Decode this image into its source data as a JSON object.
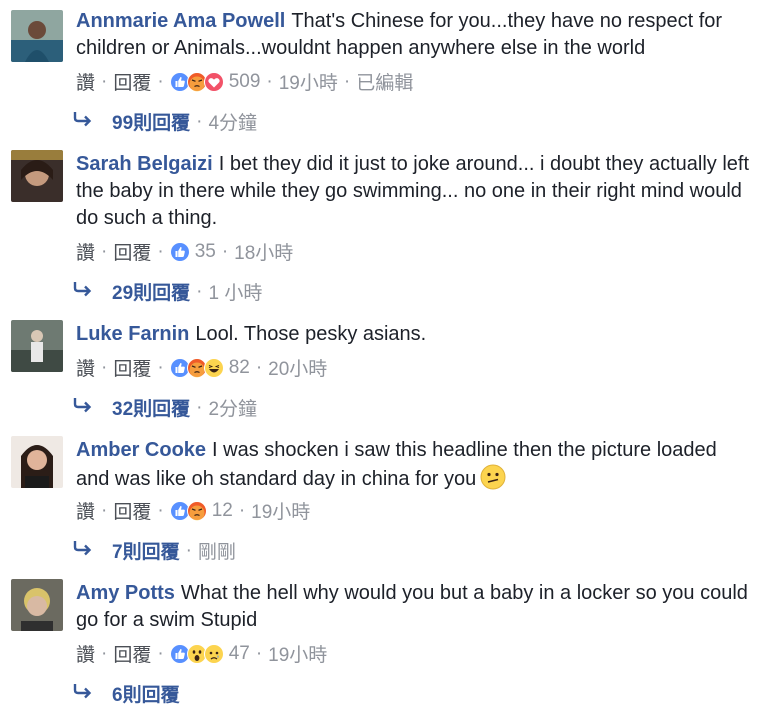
{
  "labels": {
    "like": "讚",
    "reply": "回覆",
    "dot": "·"
  },
  "comments": [
    {
      "author": "Annmarie Ama Powell",
      "text": "That's Chinese for you...they have no respect for children or Animals...wouldnt happen anywhere else in the world",
      "reactions": [
        "like-reaction-icon",
        "angry-reaction-icon",
        "love-reaction-icon"
      ],
      "count": "509",
      "time": "19小時",
      "edited": "已編輯",
      "replies_label": "99則回覆",
      "replies_time": "4分鐘"
    },
    {
      "author": "Sarah Belgaizi",
      "text": "I bet they did it just to joke around... i doubt they actually left the baby in there while they go swimming... no one in their right mind would do such a thing.",
      "reactions": [
        "like-reaction-icon"
      ],
      "count": "35",
      "time": "18小時",
      "replies_label": "29則回覆",
      "replies_time": "1 小時"
    },
    {
      "author": "Luke Farnin",
      "text": "Lool. Those pesky asians.",
      "reactions": [
        "like-reaction-icon",
        "angry-reaction-icon",
        "haha-reaction-icon"
      ],
      "count": "82",
      "time": "20小時",
      "replies_label": "32則回覆",
      "replies_time": "2分鐘"
    },
    {
      "author": "Amber Cooke",
      "text": "I was shocken i saw this headline then the picture loaded and was like oh standard day in china for you",
      "inline_emoji": "confused-emoji-icon",
      "reactions": [
        "like-reaction-icon",
        "angry-reaction-icon"
      ],
      "count": "12",
      "time": "19小時",
      "replies_label": "7則回覆",
      "replies_time": "剛剛"
    },
    {
      "author": "Amy Potts",
      "text": "What the hell why would you but a baby in a locker so you could go for a swim Stupid",
      "reactions": [
        "like-reaction-icon",
        "wow-reaction-icon",
        "sad-reaction-icon"
      ],
      "count": "47",
      "time": "19小時",
      "replies_label": "6則回覆"
    }
  ],
  "colors": {
    "author": "#365899",
    "meta": "#90949c",
    "like_blue": "#5890ff",
    "angry": "#f05b28",
    "love_red": "#f25268",
    "yellow": "#fcd44f"
  }
}
